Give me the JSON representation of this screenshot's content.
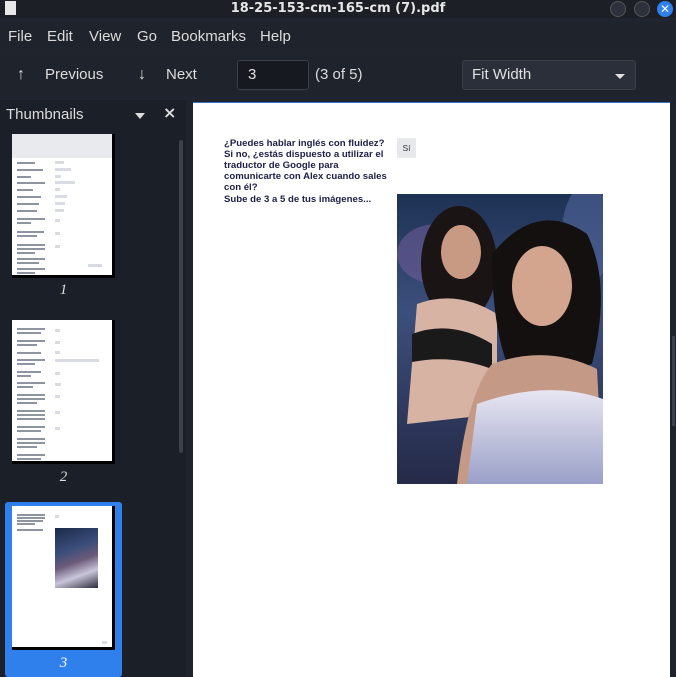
{
  "window": {
    "title": "18-25-153-cm-165-cm (7).pdf",
    "close_glyph": "✕"
  },
  "menu": [
    "File",
    "Edit",
    "View",
    "Go",
    "Bookmarks",
    "Help"
  ],
  "toolbar": {
    "previous_label": "Previous",
    "next_label": "Next",
    "previous_icon": "arrow-up-icon",
    "next_icon": "arrow-down-icon",
    "page_value": "3",
    "page_count": "(3 of 5)",
    "zoom_value": "Fit Width"
  },
  "sidebar": {
    "label": "Thumbnails",
    "close_glyph": "×",
    "thumbnails": [
      {
        "num": "1",
        "selected": false
      },
      {
        "num": "2",
        "selected": false
      },
      {
        "num": "3",
        "selected": true
      }
    ]
  },
  "document": {
    "question": "¿Puedes hablar inglés con fluidez? Si no, ¿estás dispuesto a utilizar el traductor de Google para comunicarte con Alex cuando sales con él?",
    "answer": "Sí",
    "upload_prompt": "Sube de 3 a 5 de tus imágenes..."
  },
  "colors": {
    "accent": "#2f80ed",
    "page_bg": "#ffffff",
    "app_bg": "#1f232b"
  }
}
